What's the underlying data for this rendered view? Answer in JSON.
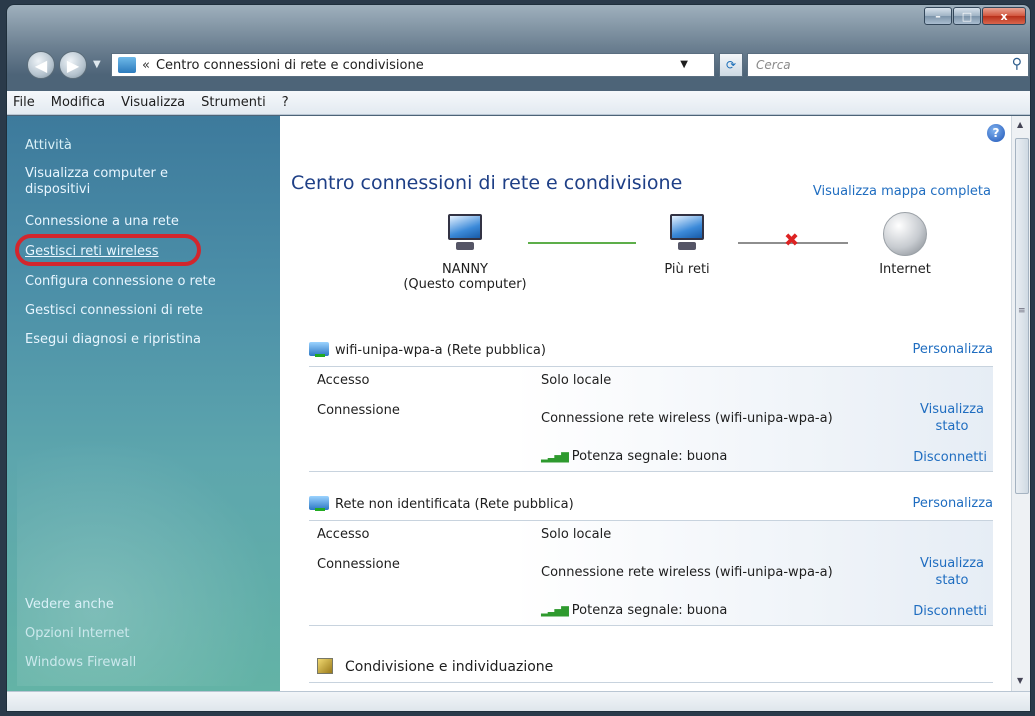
{
  "window": {
    "caption_buttons": {
      "minimize": "–",
      "maximize": "□",
      "close": "x"
    }
  },
  "address_bar": {
    "prefix": "«",
    "location": "Centro connessioni di rete e condivisione",
    "search_placeholder": "Cerca"
  },
  "menu": [
    "File",
    "Modifica",
    "Visualizza",
    "Strumenti",
    "?"
  ],
  "sidebar": {
    "tasks_heading": "Attività",
    "tasks": [
      "Visualizza computer e dispositivi",
      "Connessione a una rete",
      "Gestisci reti wireless",
      "Configura connessione o rete",
      "Gestisci connessioni di rete",
      "Esegui diagnosi e ripristina"
    ],
    "see_also_heading": "Vedere anche",
    "see_also": [
      "Opzioni Internet",
      "Windows Firewall"
    ]
  },
  "main": {
    "title": "Centro connessioni di rete e condivisione",
    "map_link": "Visualizza mappa completa",
    "map": {
      "computer_name": "NANNY",
      "computer_sub": "(Questo computer)",
      "middle": "Più reti",
      "end": "Internet",
      "link1_status": "connected",
      "link2_status": "disconnected"
    },
    "networks": [
      {
        "name": "wifi-unipa-wpa-a (Rete pubblica)",
        "customize": "Personalizza",
        "access_label": "Accesso",
        "access_value": "Solo locale",
        "connection_label": "Connessione",
        "connection_value": "Connessione rete wireless (wifi-unipa-wpa-a)",
        "view_status": "Visualizza stato",
        "signal": "Potenza segnale: buona",
        "disconnect": "Disconnetti"
      },
      {
        "name": "Rete non identificata (Rete pubblica)",
        "customize": "Personalizza",
        "access_label": "Accesso",
        "access_value": "Solo locale",
        "connection_label": "Connessione",
        "connection_value": "Connessione rete wireless (wifi-unipa-wpa-a)",
        "view_status": "Visualizza stato",
        "signal": "Potenza segnale: buona",
        "disconnect": "Disconnetti"
      }
    ],
    "sharing_heading": "Condivisione e individuazione"
  },
  "colors": {
    "link": "#1f6dc0",
    "title": "#1e3f86",
    "highlight": "#d2262d"
  }
}
